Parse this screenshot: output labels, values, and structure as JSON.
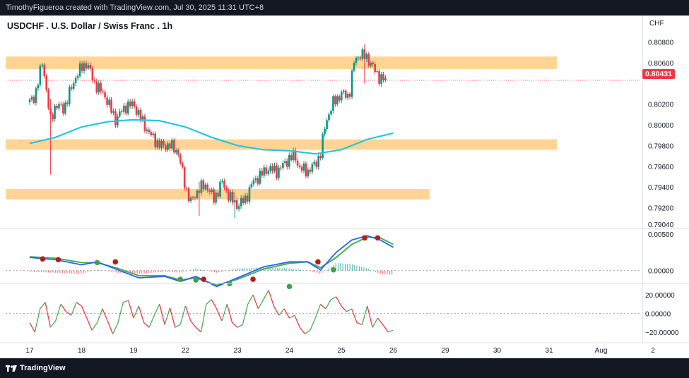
{
  "header": {
    "caption": "TimothyFigueroa created with TradingView.com, Jul 30, 2025 11:31 UTC+8"
  },
  "footer": {
    "brand": "TradingView"
  },
  "chart_data": {
    "type": "candlestick",
    "title": "USDCHF . U.S. Dollar / Swiss Franc . 1h",
    "currency": "CHF",
    "last_price": "0.80431",
    "price_axis": {
      "ticks": [
        "0.80800",
        "0.80600",
        "0.80200",
        "0.80000",
        "0.79800",
        "0.79600",
        "0.79400",
        "0.79200",
        "0.79040"
      ],
      "ylim": [
        0.7904,
        0.8092
      ]
    },
    "time_axis": {
      "ticks": [
        "17",
        "18",
        "19",
        "22",
        "23",
        "24",
        "25",
        "26",
        "29",
        "30",
        "31",
        "Aug",
        "2"
      ]
    },
    "zones": [
      {
        "from": 0.8054,
        "to": 0.8066
      },
      {
        "from": 0.7976,
        "to": 0.7986
      },
      {
        "from": 0.7928,
        "to": 0.7938
      }
    ],
    "close_path": [
      {
        "x": 0,
        "y": 0.8022
      },
      {
        "x": 0.1,
        "y": 0.8028
      },
      {
        "x": 0.25,
        "y": 0.8062
      },
      {
        "x": 0.4,
        "y": 0.8003
      },
      {
        "x": 0.5,
        "y": 0.802
      },
      {
        "x": 0.65,
        "y": 0.8015
      },
      {
        "x": 0.8,
        "y": 0.8035
      },
      {
        "x": 0.9,
        "y": 0.8048
      },
      {
        "x": 1.0,
        "y": 0.8055
      },
      {
        "x": 1.1,
        "y": 0.806
      },
      {
        "x": 1.25,
        "y": 0.804
      },
      {
        "x": 1.45,
        "y": 0.8028
      },
      {
        "x": 1.65,
        "y": 0.8005
      },
      {
        "x": 1.85,
        "y": 0.8018
      },
      {
        "x": 2.0,
        "y": 0.802
      },
      {
        "x": 2.15,
        "y": 0.8005
      },
      {
        "x": 2.3,
        "y": 0.7992
      },
      {
        "x": 2.5,
        "y": 0.798
      },
      {
        "x": 2.7,
        "y": 0.798
      },
      {
        "x": 2.85,
        "y": 0.7975
      },
      {
        "x": 3.0,
        "y": 0.794
      },
      {
        "x": 3.1,
        "y": 0.7925
      },
      {
        "x": 3.25,
        "y": 0.7938
      },
      {
        "x": 3.4,
        "y": 0.7942
      },
      {
        "x": 3.55,
        "y": 0.7928
      },
      {
        "x": 3.7,
        "y": 0.7945
      },
      {
        "x": 3.85,
        "y": 0.793
      },
      {
        "x": 4.0,
        "y": 0.7922
      },
      {
        "x": 4.15,
        "y": 0.7928
      },
      {
        "x": 4.3,
        "y": 0.7945
      },
      {
        "x": 4.45,
        "y": 0.7952
      },
      {
        "x": 4.6,
        "y": 0.7958
      },
      {
        "x": 4.75,
        "y": 0.7955
      },
      {
        "x": 4.9,
        "y": 0.7962
      },
      {
        "x": 5.0,
        "y": 0.7968
      },
      {
        "x": 5.1,
        "y": 0.797
      },
      {
        "x": 5.2,
        "y": 0.7958
      },
      {
        "x": 5.35,
        "y": 0.7955
      },
      {
        "x": 5.5,
        "y": 0.7962
      },
      {
        "x": 5.6,
        "y": 0.7972
      },
      {
        "x": 5.7,
        "y": 0.8003
      },
      {
        "x": 5.85,
        "y": 0.8022
      },
      {
        "x": 6.0,
        "y": 0.803
      },
      {
        "x": 6.15,
        "y": 0.8028
      },
      {
        "x": 6.25,
        "y": 0.8062
      },
      {
        "x": 6.35,
        "y": 0.8068
      },
      {
        "x": 6.5,
        "y": 0.8065
      },
      {
        "x": 6.65,
        "y": 0.8052
      },
      {
        "x": 6.75,
        "y": 0.8045
      },
      {
        "x": 6.85,
        "y": 0.8043
      }
    ],
    "candle_extremes": [
      {
        "x": 0.4,
        "low": 0.7952,
        "high": 0.8025
      },
      {
        "x": 3.25,
        "low": 0.7912,
        "high": 0.7945
      },
      {
        "x": 3.95,
        "low": 0.791,
        "high": 0.7935
      },
      {
        "x": 6.45,
        "low": 0.804,
        "high": 0.8078
      }
    ],
    "moving_average": {
      "color": "#26c6da",
      "points": [
        {
          "x": 0,
          "y": 0.7982
        },
        {
          "x": 0.5,
          "y": 0.7988
        },
        {
          "x": 1.0,
          "y": 0.7998
        },
        {
          "x": 1.5,
          "y": 0.8003
        },
        {
          "x": 2.0,
          "y": 0.8005
        },
        {
          "x": 2.5,
          "y": 0.8004
        },
        {
          "x": 3.0,
          "y": 0.7998
        },
        {
          "x": 3.5,
          "y": 0.7988
        },
        {
          "x": 4.0,
          "y": 0.798
        },
        {
          "x": 4.5,
          "y": 0.7976
        },
        {
          "x": 5.0,
          "y": 0.7975
        },
        {
          "x": 5.5,
          "y": 0.7972
        },
        {
          "x": 6.0,
          "y": 0.7976
        },
        {
          "x": 6.5,
          "y": 0.7986
        },
        {
          "x": 7.0,
          "y": 0.7992
        }
      ]
    },
    "macd_panel": {
      "ticks": [
        "0.00500",
        "0.00000"
      ],
      "ylim": [
        -0.001,
        0.0055
      ],
      "macd": [
        {
          "x": 0,
          "y": 0.0018
        },
        {
          "x": 0.5,
          "y": 0.0015
        },
        {
          "x": 1.0,
          "y": 0.0008
        },
        {
          "x": 1.3,
          "y": 0.0012
        },
        {
          "x": 1.7,
          "y": 0.0001
        },
        {
          "x": 2.1,
          "y": -0.001
        },
        {
          "x": 2.6,
          "y": -0.0008
        },
        {
          "x": 2.9,
          "y": -0.0015
        },
        {
          "x": 3.2,
          "y": -0.0008
        },
        {
          "x": 3.6,
          "y": -0.0022
        },
        {
          "x": 4.0,
          "y": -0.001
        },
        {
          "x": 4.5,
          "y": 0.0005
        },
        {
          "x": 5.0,
          "y": 0.0012
        },
        {
          "x": 5.35,
          "y": 0.0012
        },
        {
          "x": 5.6,
          "y": 0.0001
        },
        {
          "x": 5.9,
          "y": 0.0025
        },
        {
          "x": 6.2,
          "y": 0.0042
        },
        {
          "x": 6.5,
          "y": 0.0048
        },
        {
          "x": 6.75,
          "y": 0.0042
        },
        {
          "x": 7.0,
          "y": 0.0032
        }
      ],
      "signal": [
        {
          "x": 0,
          "y": 0.0019
        },
        {
          "x": 0.5,
          "y": 0.0017
        },
        {
          "x": 1.0,
          "y": 0.0011
        },
        {
          "x": 1.3,
          "y": 0.0011
        },
        {
          "x": 1.7,
          "y": 0.0003
        },
        {
          "x": 2.1,
          "y": -0.0007
        },
        {
          "x": 2.6,
          "y": -0.0007
        },
        {
          "x": 2.9,
          "y": -0.0013
        },
        {
          "x": 3.2,
          "y": -0.001
        },
        {
          "x": 3.6,
          "y": -0.002
        },
        {
          "x": 4.0,
          "y": -0.0012
        },
        {
          "x": 4.5,
          "y": 0.0002
        },
        {
          "x": 5.0,
          "y": 0.001
        },
        {
          "x": 5.35,
          "y": 0.0012
        },
        {
          "x": 5.6,
          "y": 0.0004
        },
        {
          "x": 5.9,
          "y": 0.0018
        },
        {
          "x": 6.2,
          "y": 0.0036
        },
        {
          "x": 6.5,
          "y": 0.0046
        },
        {
          "x": 6.75,
          "y": 0.0045
        },
        {
          "x": 7.0,
          "y": 0.0036
        }
      ],
      "cross_markers": [
        {
          "x": 0.25,
          "y": 0.0016,
          "color": "#b71c1c"
        },
        {
          "x": 0.55,
          "y": 0.0015,
          "color": "#b71c1c"
        },
        {
          "x": 1.3,
          "y": 0.0011,
          "color": "#43a047"
        },
        {
          "x": 1.65,
          "y": 0.0012,
          "color": "#b71c1c"
        },
        {
          "x": 2.9,
          "y": -0.0012,
          "color": "#43a047"
        },
        {
          "x": 3.2,
          "y": -0.0013,
          "color": "#43a047"
        },
        {
          "x": 3.35,
          "y": -0.0012,
          "color": "#b71c1c"
        },
        {
          "x": 3.85,
          "y": -0.0018,
          "color": "#43a047"
        },
        {
          "x": 4.3,
          "y": -0.0012,
          "color": "#b71c1c"
        },
        {
          "x": 5.0,
          "y": -0.0022,
          "color": "#43a047"
        },
        {
          "x": 5.55,
          "y": 0.0012,
          "color": "#b71c1c"
        },
        {
          "x": 5.85,
          "y": 0.0001,
          "color": "#43a047"
        },
        {
          "x": 6.45,
          "y": 0.0045,
          "color": "#b71c1c"
        },
        {
          "x": 6.7,
          "y": 0.0045,
          "color": "#b71c1c"
        }
      ]
    },
    "oscillator_panel": {
      "ticks": [
        "20.00000",
        "0.00000",
        "−20.00000"
      ],
      "ylim": [
        -30,
        30
      ],
      "zero_line": 0,
      "values": [
        {
          "x": 0,
          "y": -10
        },
        {
          "x": 0.1,
          "y": -20
        },
        {
          "x": 0.2,
          "y": 5
        },
        {
          "x": 0.3,
          "y": 12
        },
        {
          "x": 0.4,
          "y": -15
        },
        {
          "x": 0.5,
          "y": -8
        },
        {
          "x": 0.6,
          "y": 10
        },
        {
          "x": 0.7,
          "y": 2
        },
        {
          "x": 0.8,
          "y": -2
        },
        {
          "x": 0.9,
          "y": 12
        },
        {
          "x": 1.0,
          "y": 8
        },
        {
          "x": 1.1,
          "y": -5
        },
        {
          "x": 1.2,
          "y": -18
        },
        {
          "x": 1.3,
          "y": -10
        },
        {
          "x": 1.4,
          "y": 5
        },
        {
          "x": 1.5,
          "y": -8
        },
        {
          "x": 1.6,
          "y": -22
        },
        {
          "x": 1.7,
          "y": -10
        },
        {
          "x": 1.8,
          "y": 12
        },
        {
          "x": 1.9,
          "y": 14
        },
        {
          "x": 2.0,
          "y": -5
        },
        {
          "x": 2.1,
          "y": 8
        },
        {
          "x": 2.2,
          "y": -10
        },
        {
          "x": 2.3,
          "y": -15
        },
        {
          "x": 2.4,
          "y": -2
        },
        {
          "x": 2.5,
          "y": 10
        },
        {
          "x": 2.6,
          "y": -12
        },
        {
          "x": 2.7,
          "y": 6
        },
        {
          "x": 2.8,
          "y": -15
        },
        {
          "x": 2.9,
          "y": -12
        },
        {
          "x": 3.0,
          "y": 8
        },
        {
          "x": 3.1,
          "y": -8
        },
        {
          "x": 3.2,
          "y": -15
        },
        {
          "x": 3.3,
          "y": -20
        },
        {
          "x": 3.4,
          "y": 10
        },
        {
          "x": 3.5,
          "y": 15
        },
        {
          "x": 3.6,
          "y": 5
        },
        {
          "x": 3.7,
          "y": -8
        },
        {
          "x": 3.8,
          "y": 10
        },
        {
          "x": 3.9,
          "y": -10
        },
        {
          "x": 4.0,
          "y": -15
        },
        {
          "x": 4.1,
          "y": -12
        },
        {
          "x": 4.2,
          "y": 10
        },
        {
          "x": 4.3,
          "y": 20
        },
        {
          "x": 4.4,
          "y": 5
        },
        {
          "x": 4.5,
          "y": 15
        },
        {
          "x": 4.6,
          "y": 25
        },
        {
          "x": 4.7,
          "y": 8
        },
        {
          "x": 4.8,
          "y": -2
        },
        {
          "x": 4.9,
          "y": 5
        },
        {
          "x": 5.0,
          "y": -5
        },
        {
          "x": 5.1,
          "y": -2
        },
        {
          "x": 5.2,
          "y": -15
        },
        {
          "x": 5.3,
          "y": -22
        },
        {
          "x": 5.4,
          "y": -18
        },
        {
          "x": 5.5,
          "y": -5
        },
        {
          "x": 5.6,
          "y": 10
        },
        {
          "x": 5.7,
          "y": 5
        },
        {
          "x": 5.8,
          "y": 15
        },
        {
          "x": 5.9,
          "y": 18
        },
        {
          "x": 6.0,
          "y": 8
        },
        {
          "x": 6.1,
          "y": 2
        },
        {
          "x": 6.2,
          "y": 5
        },
        {
          "x": 6.3,
          "y": -10
        },
        {
          "x": 6.4,
          "y": -12
        },
        {
          "x": 6.5,
          "y": 8
        },
        {
          "x": 6.6,
          "y": -15
        },
        {
          "x": 6.7,
          "y": -5
        },
        {
          "x": 6.8,
          "y": -12
        },
        {
          "x": 6.9,
          "y": -20
        },
        {
          "x": 7.0,
          "y": -18
        }
      ]
    },
    "colors": {
      "up": "#089981",
      "down": "#f23645",
      "zone": "#ffb74d",
      "macd": "#2962ff",
      "signal": "#4caf50",
      "osc_up": "#4caf50",
      "osc_down": "#f23645"
    }
  }
}
